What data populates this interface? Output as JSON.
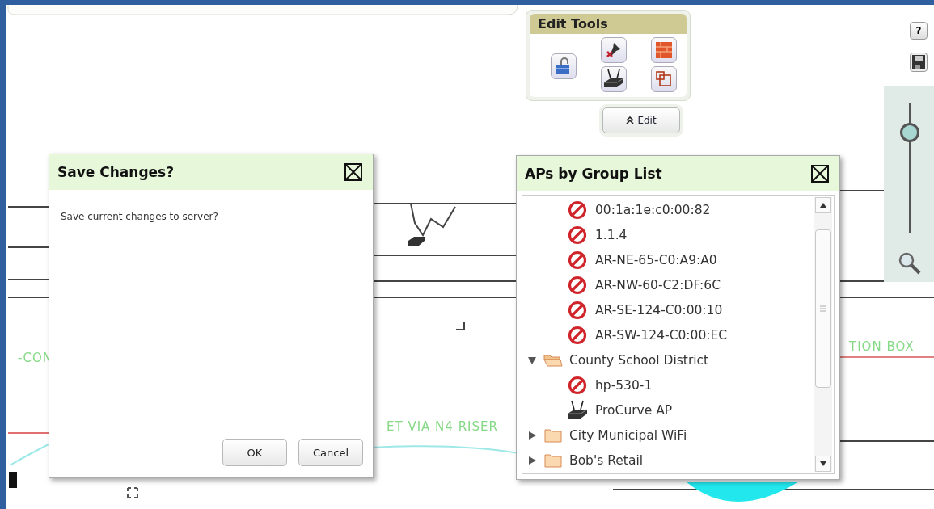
{
  "edit_tools": {
    "title": "Edit Tools",
    "tab_label": "Edit"
  },
  "map_controls": {
    "help_label": "?",
    "zoom_slider": {
      "level": 0.77
    }
  },
  "floorplan_labels": [
    {
      "text": "-CON"
    },
    {
      "text": "ET VIA N4 RISER"
    },
    {
      "text": "TION BOX"
    }
  ],
  "save_dialog": {
    "title": "Save Changes?",
    "message": "Save current changes to server?",
    "buttons": [
      "OK",
      "Cancel"
    ]
  },
  "aps_dialog": {
    "title": "APs by Group List",
    "tree": [
      {
        "kind": "group-continued",
        "children": [
          {
            "kind": "blocked-ap",
            "label": "00:1a:1e:c0:00:82"
          },
          {
            "kind": "blocked-ap",
            "label": "1.1.4"
          },
          {
            "kind": "blocked-ap",
            "label": "AR-NE-65-C0:A9:A0"
          },
          {
            "kind": "blocked-ap",
            "label": "AR-NW-60-C2:DF:6C"
          },
          {
            "kind": "blocked-ap",
            "label": "AR-SE-124-C0:00:10"
          },
          {
            "kind": "blocked-ap",
            "label": "AR-SW-124-C0:00:EC"
          }
        ]
      },
      {
        "kind": "group",
        "label": "County School District",
        "expanded": true,
        "children": [
          {
            "kind": "blocked-ap",
            "label": "hp-530-1"
          },
          {
            "kind": "ap",
            "label": "ProCurve AP"
          }
        ]
      },
      {
        "kind": "group",
        "label": "City Municipal WiFi",
        "expanded": false
      },
      {
        "kind": "group",
        "label": "Bob's Retail",
        "expanded": false
      }
    ]
  }
}
